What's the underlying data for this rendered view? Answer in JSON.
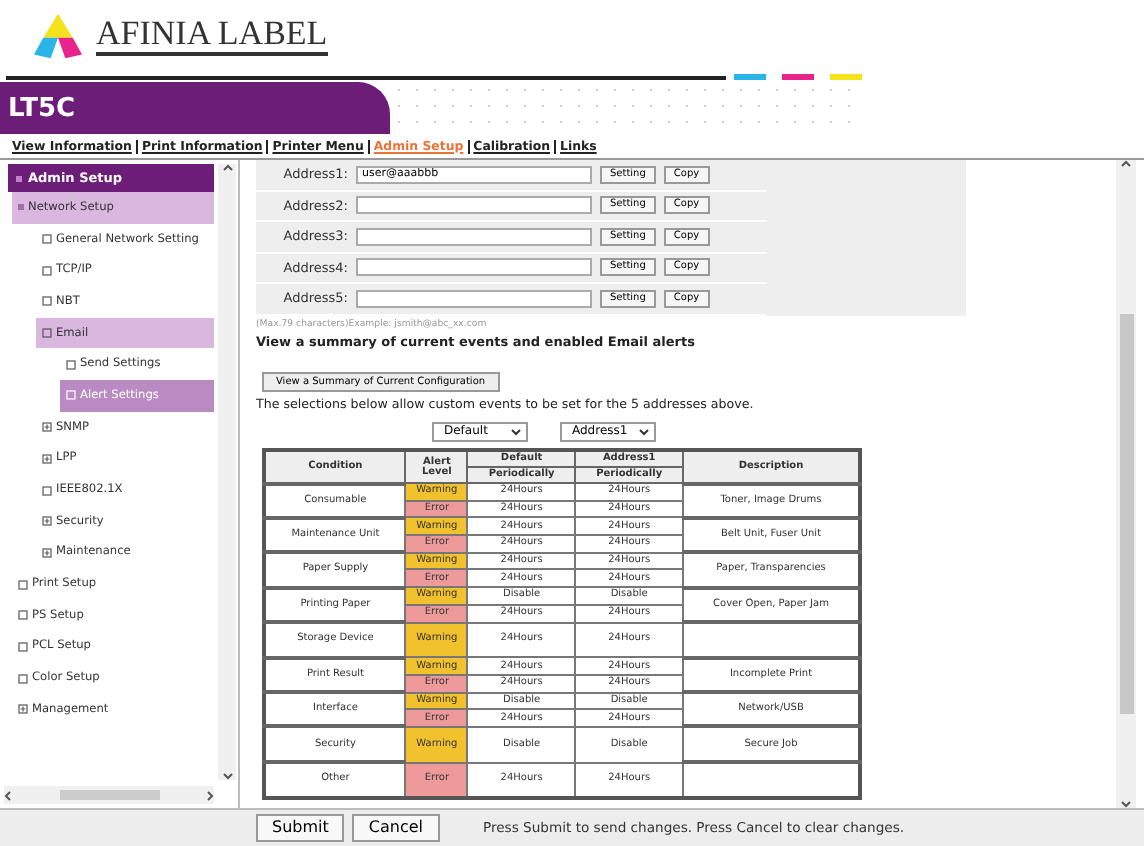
{
  "logo": {
    "text": "AFINIA LABEL"
  },
  "header": {
    "model": "LT5C"
  },
  "nav": [
    {
      "label": "View Information",
      "selected": false
    },
    {
      "label": "Print Information",
      "selected": false
    },
    {
      "label": "Printer Menu",
      "selected": false
    },
    {
      "label": "Admin Setup",
      "selected": true
    },
    {
      "label": "Calibration",
      "selected": false
    },
    {
      "label": "Links",
      "selected": false
    }
  ],
  "sidebar": {
    "title": "Admin Setup",
    "items": [
      {
        "label": "Network Setup",
        "kind": "group",
        "selected": false,
        "expanded": true,
        "children": [
          {
            "label": "General Network Setting",
            "kind": "page",
            "selected": false
          },
          {
            "label": "TCP/IP",
            "kind": "page",
            "selected": false
          },
          {
            "label": "NBT",
            "kind": "page",
            "selected": false
          },
          {
            "label": "Email",
            "kind": "page",
            "selected": false,
            "expanded": true,
            "children": [
              {
                "label": "Send Settings",
                "kind": "page",
                "selected": false
              },
              {
                "label": "Alert Settings",
                "kind": "page",
                "selected": true
              }
            ]
          },
          {
            "label": "SNMP",
            "kind": "folder",
            "selected": false
          },
          {
            "label": "LPP",
            "kind": "folder",
            "selected": false
          },
          {
            "label": "IEEE802.1X",
            "kind": "page",
            "selected": false
          },
          {
            "label": "Security",
            "kind": "folder",
            "selected": false
          },
          {
            "label": "Maintenance",
            "kind": "folder",
            "selected": false
          }
        ]
      },
      {
        "label": "Print Setup",
        "kind": "page",
        "selected": false
      },
      {
        "label": "PS Setup",
        "kind": "page",
        "selected": false
      },
      {
        "label": "PCL Setup",
        "kind": "page",
        "selected": false
      },
      {
        "label": "Color Setup",
        "kind": "page",
        "selected": false
      },
      {
        "label": "Management",
        "kind": "folder",
        "selected": false
      }
    ]
  },
  "addresses": [
    {
      "label": "Address1:",
      "value": "user@aaabbb",
      "setting": "Setting",
      "copy": "Copy"
    },
    {
      "label": "Address2:",
      "setting": "Setting",
      "copy": "Copy"
    },
    {
      "label": "Address3:",
      "setting": "Setting",
      "copy": "Copy"
    },
    {
      "label": "Address4:",
      "setting": "Setting",
      "copy": "Copy"
    },
    {
      "label": "Address5:",
      "setting": "Setting",
      "copy": "Copy"
    }
  ],
  "note": "(Max.79 characters)Example: jsmith@abc_xx.com",
  "summary": {
    "heading": "View a summary of current events and enabled Email alerts",
    "button": "View a Summary of Current Configuration"
  },
  "selections_text": "The selections below allow custom events to be set for the 5 addresses above.",
  "selects": [
    "Default",
    "Address1"
  ],
  "table": {
    "columns": [
      {
        "label": "Condition"
      },
      {
        "label": "Alert Level"
      },
      {
        "label": "Default",
        "sub": "Periodically"
      },
      {
        "label": "Address1",
        "sub": "Periodically"
      },
      {
        "label": "Description"
      }
    ],
    "rows": [
      {
        "condition": "Consumable",
        "description": "Toner, Image Drums",
        "alerts": [
          {
            "level": "Warning",
            "color": "#f2c12e",
            "default": "24Hours",
            "address1": "24Hours"
          },
          {
            "level": "Error",
            "color": "#ee9a9a",
            "default": "24Hours",
            "address1": "24Hours"
          }
        ]
      },
      {
        "condition": "Maintenance Unit",
        "description": "Belt Unit, Fuser Unit",
        "alerts": [
          {
            "level": "Warning",
            "color": "#f2c12e",
            "default": "24Hours",
            "address1": "24Hours"
          },
          {
            "level": "Error",
            "color": "#ee9a9a",
            "default": "24Hours",
            "address1": "24Hours"
          }
        ]
      },
      {
        "condition": "Paper Supply",
        "description": "Paper, Transparencies",
        "alerts": [
          {
            "level": "Warning",
            "color": "#f2c12e",
            "default": "24Hours",
            "address1": "24Hours"
          },
          {
            "level": "Error",
            "color": "#ee9a9a",
            "default": "24Hours",
            "address1": "24Hours"
          }
        ]
      },
      {
        "condition": "Printing Paper",
        "description": "Cover Open, Paper Jam",
        "alerts": [
          {
            "level": "Warning",
            "color": "#f2c12e",
            "default": "Disable",
            "address1": "Disable"
          },
          {
            "level": "Error",
            "color": "#ee9a9a",
            "default": "24Hours",
            "address1": "24Hours"
          }
        ]
      },
      {
        "condition": "Storage Device",
        "alerts": [
          {
            "level": "Warning",
            "color": "#f2c12e",
            "default": "24Hours",
            "address1": "24Hours"
          }
        ]
      },
      {
        "condition": "Print Result",
        "description": "Incomplete Print",
        "alerts": [
          {
            "level": "Warning",
            "color": "#f2c12e",
            "default": "24Hours",
            "address1": "24Hours"
          },
          {
            "level": "Error",
            "color": "#ee9a9a",
            "default": "24Hours",
            "address1": "24Hours"
          }
        ]
      },
      {
        "condition": "Interface",
        "description": "Network/USB",
        "alerts": [
          {
            "level": "Warning",
            "color": "#f2c12e",
            "default": "Disable",
            "address1": "Disable"
          },
          {
            "level": "Error",
            "color": "#ee9a9a",
            "default": "24Hours",
            "address1": "24Hours"
          }
        ]
      },
      {
        "condition": "Security",
        "description": "Secure Job",
        "alerts": [
          {
            "level": "Warning",
            "color": "#f2c12e",
            "default": "Disable",
            "address1": "Disable"
          }
        ]
      },
      {
        "condition": "Other",
        "alerts": [
          {
            "level": "Error",
            "color": "#ee9a9a",
            "default": "24Hours",
            "address1": "24Hours"
          }
        ]
      }
    ]
  },
  "footer": {
    "submit": "Submit",
    "cancel": "Cancel",
    "message": "Press Submit to send changes. Press Cancel to clear changes."
  }
}
